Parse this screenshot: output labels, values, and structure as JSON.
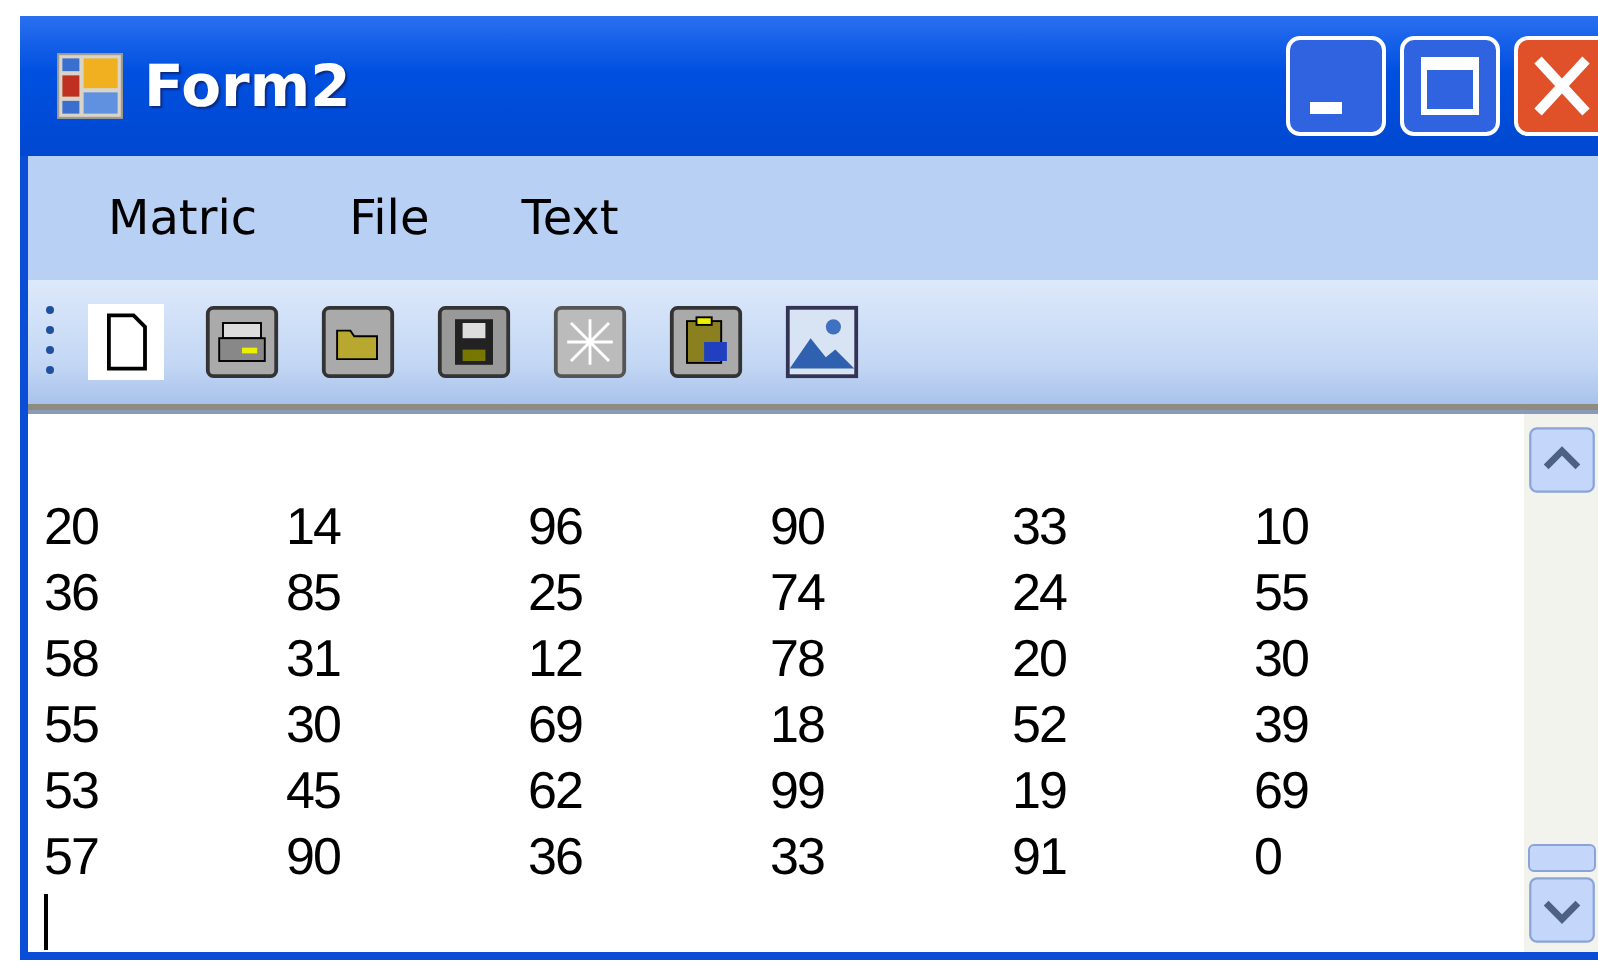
{
  "window": {
    "title": "Form2"
  },
  "menu": [
    {
      "label": "Matric"
    },
    {
      "label": "File"
    },
    {
      "label": "Text"
    }
  ],
  "text_area": {
    "rows": [
      [
        "20",
        "14",
        "96",
        "90",
        "33",
        "10"
      ],
      [
        "36",
        "85",
        "25",
        "74",
        "24",
        "55"
      ],
      [
        "58",
        "31",
        "12",
        "78",
        "20",
        "30"
      ],
      [
        "55",
        "30",
        "69",
        "18",
        "52",
        "39"
      ],
      [
        "53",
        "45",
        "62",
        "99",
        "19",
        "69"
      ],
      [
        "57",
        "90",
        "36",
        "33",
        "91",
        "0"
      ]
    ]
  }
}
